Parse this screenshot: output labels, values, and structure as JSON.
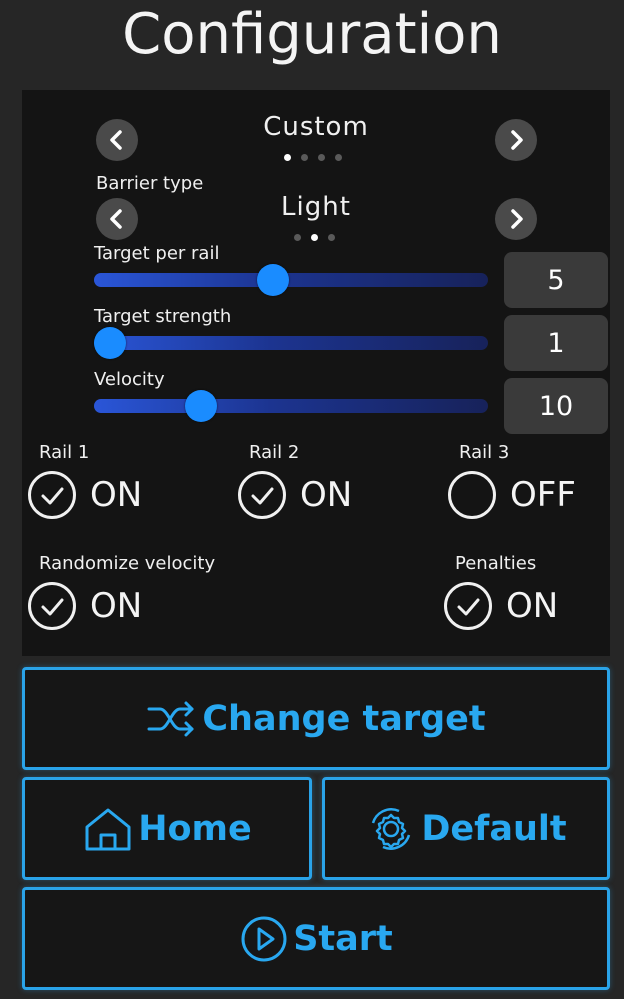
{
  "title": "Configuration",
  "preset": {
    "value": "Custom",
    "dot_count": 4,
    "active_dot": 0,
    "prev_icon": "chevron-left-icon",
    "next_icon": "chevron-right-icon"
  },
  "barrier": {
    "label": "Barrier type",
    "value": "Light",
    "dot_count": 3,
    "active_dot": 1,
    "prev_icon": "chevron-left-icon",
    "next_icon": "chevron-right-icon"
  },
  "sliders": [
    {
      "label": "Target per rail",
      "value": "5",
      "fraction": 0.45
    },
    {
      "label": "Target strength",
      "value": "1",
      "fraction": 0.0
    },
    {
      "label": "Velocity",
      "value": "10",
      "fraction": 0.25
    }
  ],
  "rails": [
    {
      "label": "Rail 1",
      "state": "ON",
      "checked": true
    },
    {
      "label": "Rail 2",
      "state": "ON",
      "checked": true
    },
    {
      "label": "Rail 3",
      "state": "OFF",
      "checked": false
    }
  ],
  "randomize": {
    "label": "Randomize velocity",
    "state": "ON",
    "checked": true
  },
  "penalties": {
    "label": "Penalties",
    "state": "ON",
    "checked": true
  },
  "buttons": {
    "change_target": {
      "label": "Change target",
      "icon": "shuffle-icon"
    },
    "home": {
      "label": "Home",
      "icon": "home-icon"
    },
    "default": {
      "label": "Default",
      "icon": "gear-refresh-icon"
    },
    "start": {
      "label": "Start",
      "icon": "play-icon"
    }
  },
  "colors": {
    "accent": "#29a8f0",
    "slider_thumb": "#1a8cff",
    "panel_bg": "#141414",
    "page_bg": "#262626"
  }
}
